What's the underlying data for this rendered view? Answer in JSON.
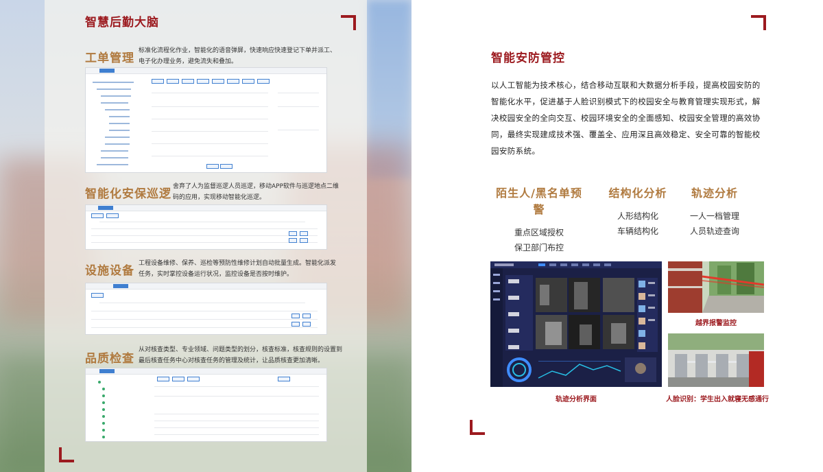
{
  "left": {
    "main_title": "智慧后勤大脑",
    "sections": [
      {
        "title": "工单管理",
        "desc_lines": [
          "标准化流程化作业，智能化的语音弹屏，快速响应快速登记下单并派工、",
          "电子化办理业务，避免流失和叠加。"
        ]
      },
      {
        "title": "智能化安保巡逻",
        "desc_lines": [
          "舍弃了人为监督巡逻人员巡逻，移动APP软件与巡逻地点二维",
          "码的应用，实现移动智能化巡逻。"
        ]
      },
      {
        "title": "设施设备",
        "desc_lines": [
          "工程设备维修、保养、巡检等预防性维修计划自动批量生成。智能化派发",
          "任务，实时掌控设备运行状况，监控设备是否按时维护。"
        ]
      },
      {
        "title": "品质检查",
        "desc_lines": [
          "从对核查类型、专业领域、问题类型的划分，核查标准，核查规则的设置到",
          "最后核查任务中心对核查任务的管理及统计，让品质核查更加清晰。"
        ]
      }
    ]
  },
  "right": {
    "title": "智能安防管控",
    "paragraph": "以人工智能为技术核心，结合移动互联和大数据分析手段，提高校园安防的智能化水平，促进基于人脸识别模式下的校园安全与教育管理实现形式，解决校园安全的全向交互、校园环境安全的全面感知、校园安全管理的高效协同，最终实现建成技术强、覆盖全、应用深且高效稳定、安全可靠的智能校园安防系统。",
    "features": [
      {
        "title": "陌生人/黑名单预警",
        "items": [
          "重点区域授权",
          "保卫部门布控"
        ]
      },
      {
        "title": "结构化分析",
        "items": [
          "人形结构化",
          "车辆结构化"
        ]
      },
      {
        "title": "轨迹分析",
        "items": [
          "一人一档管理",
          "人员轨迹查询"
        ]
      }
    ],
    "captions": {
      "main": "轨迹分析界面",
      "top": "越界报警监控",
      "bottom": "人脸识别：学生出入就寝无感通行"
    }
  },
  "colors": {
    "brand_red": "#9c1a1f",
    "gold": "#b07a3f",
    "dashboard_bg": "#1b2046"
  }
}
